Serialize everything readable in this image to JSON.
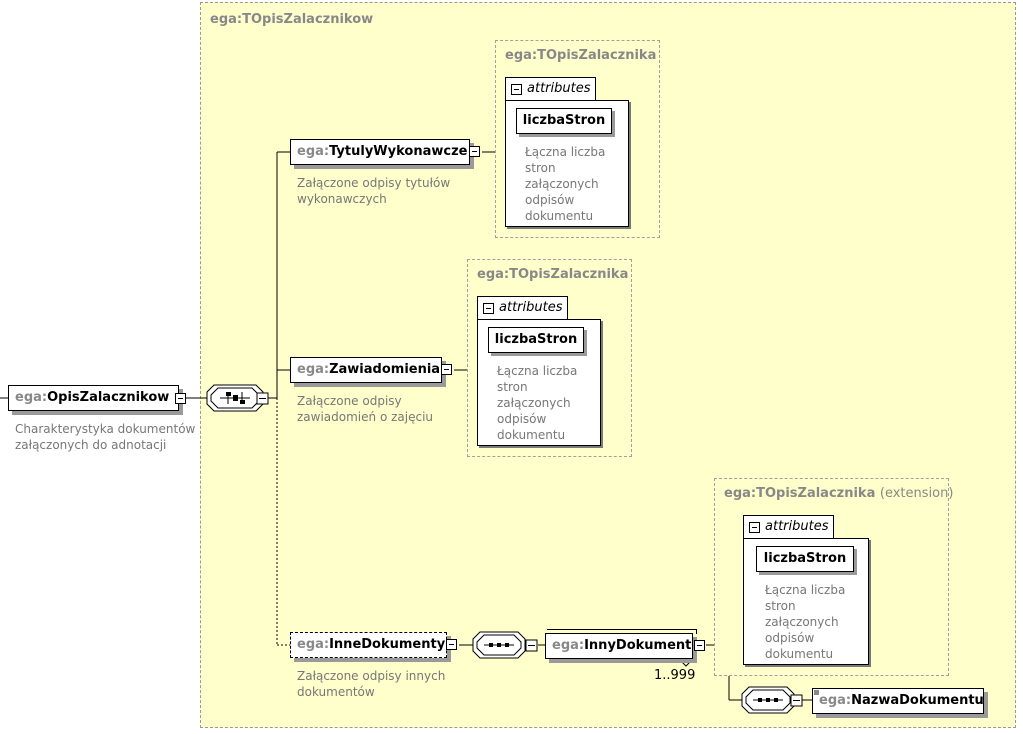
{
  "namespace_prefix": "ega:",
  "outer_type": {
    "title": "ega:TOpisZalacznikow"
  },
  "root": {
    "name": "OpisZalacznikow",
    "annotation_line1": "Charakterystyka dokumentów",
    "annotation_line2": "załączonych do adnotacji"
  },
  "children": [
    {
      "name": "TytulyWykonawcze",
      "annotation_line1": "Załączone odpisy tytułów",
      "annotation_line2": "wykonawczych",
      "type_title": "ega:TOpisZalacznika",
      "attributes_label": "attributes",
      "attribute_name": "liczbaStron",
      "attribute_desc": "Łączna liczba\nstron\nzałączonych\nodpisów\ndokumentu"
    },
    {
      "name": "Zawiadomienia",
      "annotation_line1": "Załączone odpisy",
      "annotation_line2": "zawiadomień o zajęciu",
      "type_title": "ega:TOpisZalacznika",
      "attributes_label": "attributes",
      "attribute_name": "liczbaStron",
      "attribute_desc": "Łączna liczba\nstron\nzałączonych\nodpisów\ndokumentu"
    },
    {
      "name": "InneDokumenty",
      "optional": true,
      "annotation_line1": "Załączone odpisy innych",
      "annotation_line2": "dokumentów"
    }
  ],
  "inny_dokument": {
    "name": "InnyDokument",
    "occurs": "1..999",
    "type_title": "ega:TOpisZalacznika",
    "type_extension": "(extension)",
    "attributes_label": "attributes",
    "attribute_name": "liczbaStron",
    "attribute_desc": "Łączna liczba\nstron\nzałączonych\nodpisów\ndokumentu",
    "child_name": "NazwaDokumentu"
  },
  "colors": {
    "type_background": "#ffffcc",
    "namespace_text": "#888888",
    "annotation_text": "#777777",
    "border": "#000000"
  }
}
